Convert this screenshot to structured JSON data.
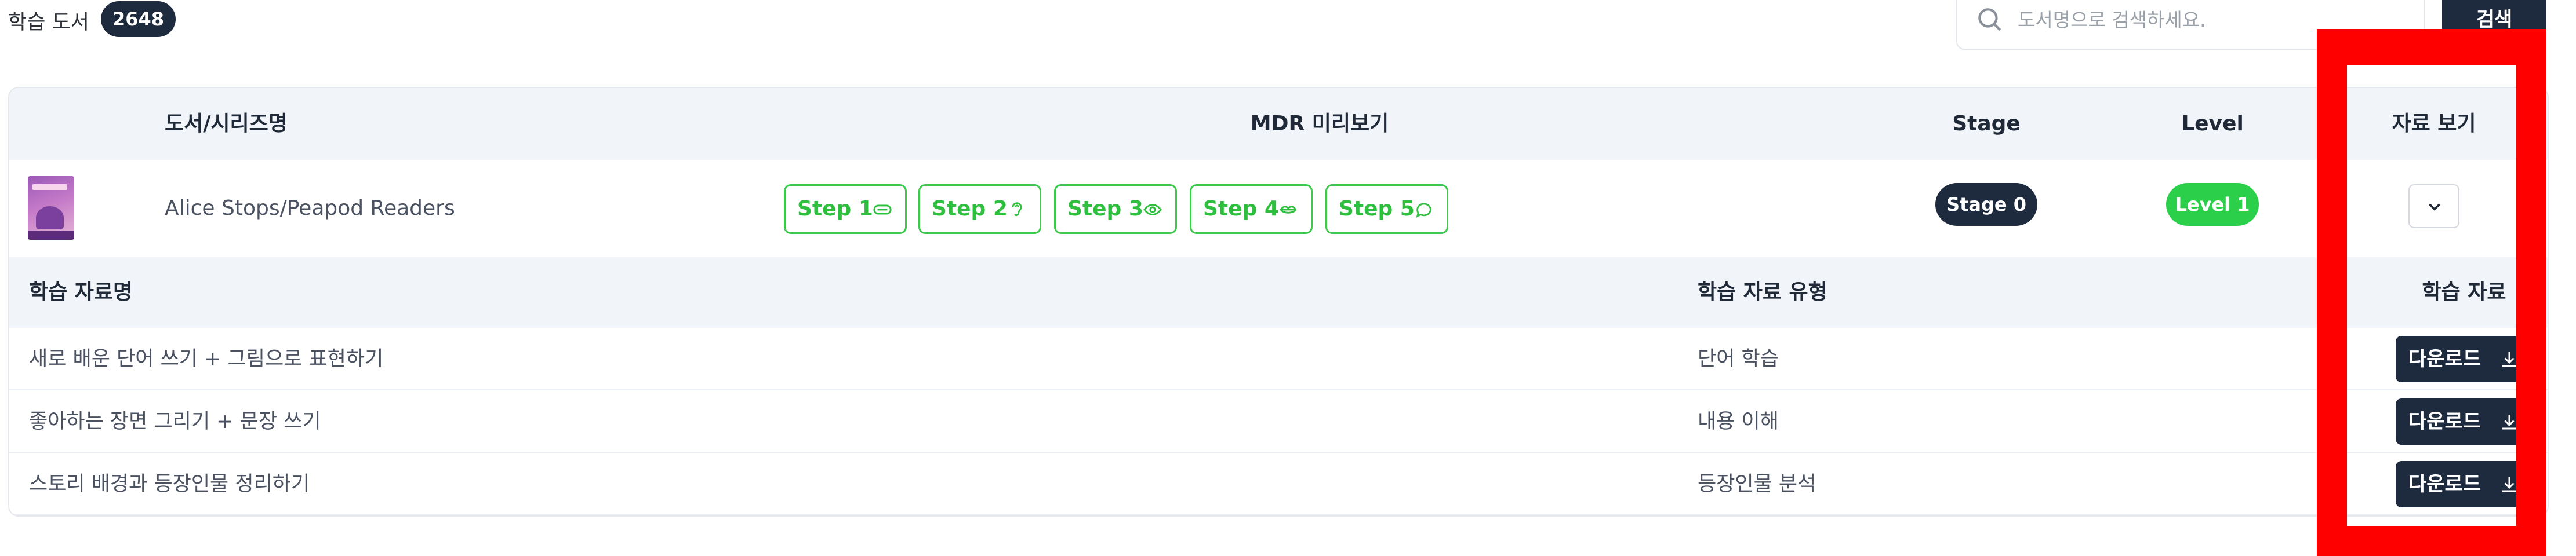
{
  "header": {
    "title": "학습 도서",
    "count": "2648",
    "search_placeholder": "도서명으로 검색하세요.",
    "search_button": "검색"
  },
  "book_table": {
    "columns": {
      "title": "도서/시리즈명",
      "mdr": "MDR 미리보기",
      "stage": "Stage",
      "level": "Level",
      "materials": "자료 보기"
    },
    "book": {
      "title": "Alice Stops/Peapod Readers",
      "steps": [
        {
          "label": "Step 1",
          "icon": "mouth-icon"
        },
        {
          "label": "Step 2",
          "icon": "ear-icon"
        },
        {
          "label": "Step 3",
          "icon": "eye-icon"
        },
        {
          "label": "Step 4",
          "icon": "lips-icon"
        },
        {
          "label": "Step 5",
          "icon": "speech-bubble-icon"
        }
      ],
      "stage": "Stage 0",
      "level": "Level 1"
    }
  },
  "materials_table": {
    "columns": {
      "name": "학습 자료명",
      "type": "학습 자료 유형",
      "download": "학습 자료"
    },
    "rows": [
      {
        "name": "새로 배운 단어 쓰기 + 그림으로 표현하기",
        "type": "단어 학습",
        "download_label": "다운로드"
      },
      {
        "name": "좋아하는 장면 그리기 + 문장 쓰기",
        "type": "내용 이해",
        "download_label": "다운로드"
      },
      {
        "name": "스토리 배경과 등장인물 정리하기",
        "type": "등장인물 분석",
        "download_label": "다운로드"
      }
    ]
  },
  "colors": {
    "navy": "#1e2a3d",
    "green": "#2bcf4a",
    "highlight": "#ff0000"
  }
}
